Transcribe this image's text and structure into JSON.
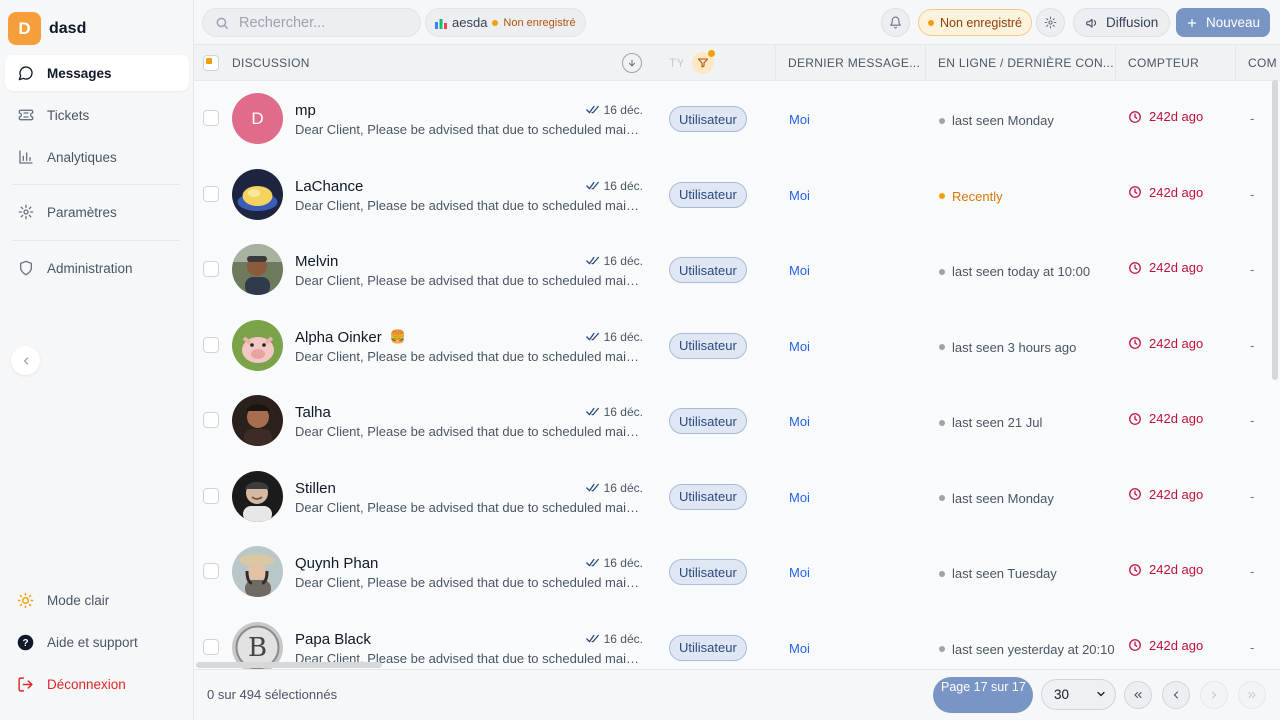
{
  "app": {
    "initial": "D",
    "name": "dasd"
  },
  "sidebar": {
    "items": [
      {
        "label": "Messages",
        "icon": "message-circle-icon",
        "active": true
      },
      {
        "label": "Tickets",
        "icon": "ticket-icon"
      },
      {
        "label": "Analytiques",
        "icon": "bar-chart-icon"
      },
      {
        "label": "Paramètres",
        "icon": "gear-icon"
      },
      {
        "label": "Administration",
        "icon": "shield-icon"
      }
    ],
    "bottom": [
      {
        "label": "Mode clair",
        "icon": "sun-icon"
      },
      {
        "label": "Aide et support",
        "icon": "help-circle-icon"
      },
      {
        "label": "Déconnexion",
        "icon": "logout-icon"
      }
    ]
  },
  "topbar": {
    "search_placeholder": "Rechercher...",
    "workspace": {
      "name": "aesda",
      "status": "Non enregistré"
    },
    "status_pill": "Non enregistré",
    "diffusion_label": "Diffusion",
    "new_label": "Nouveau"
  },
  "table": {
    "headers": {
      "discussion": "DISCUSSION",
      "type": "TY",
      "last_message": "DERNIER MESSAGE...",
      "online": "EN LIGNE / DERNIÈRE CON...",
      "counter": "COMPTEUR",
      "extra": "COM"
    },
    "rows": [
      {
        "name": "mp",
        "preview": "Dear Client, Please be advised that due to scheduled maintenance",
        "date": "16 déc.",
        "type": "Utilisateur",
        "last_by": "Moi",
        "online": "last seen Monday",
        "recent": false,
        "counter": "242d ago",
        "extra": "-",
        "avatar": "letter",
        "letter": "D"
      },
      {
        "name": "LaChance",
        "preview": "Dear Client, Please be advised that due to scheduled maintenance",
        "date": "16 déc.",
        "type": "Utilisateur",
        "last_by": "Moi",
        "online": "Recently",
        "recent": true,
        "counter": "242d ago",
        "extra": "-",
        "avatar": "photo-food"
      },
      {
        "name": "Melvin",
        "preview": "Dear Client, Please be advised that due to scheduled maintenance",
        "date": "16 déc.",
        "type": "Utilisateur",
        "last_by": "Moi",
        "online": "last seen today at 10:00",
        "recent": false,
        "counter": "242d ago",
        "extra": "-",
        "avatar": "photo-man-outdoor"
      },
      {
        "name": "Alpha Oinker",
        "name_badge": "🍔",
        "preview": "Dear Client, Please be advised that due to scheduled maintenance",
        "date": "16 déc.",
        "type": "Utilisateur",
        "last_by": "Moi",
        "online": "last seen 3 hours ago",
        "recent": false,
        "counter": "242d ago",
        "extra": "-",
        "avatar": "photo-pig"
      },
      {
        "name": "Talha",
        "preview": "Dear Client, Please be advised that due to scheduled maintenance",
        "date": "16 déc.",
        "type": "Utilisateur",
        "last_by": "Moi",
        "online": "last seen 21 Jul",
        "recent": false,
        "counter": "242d ago",
        "extra": "-",
        "avatar": "photo-man-dark"
      },
      {
        "name": "Stillen",
        "preview": "Dear Client, Please be advised that due to scheduled maintenance",
        "date": "16 déc.",
        "type": "Utilisateur",
        "last_by": "Moi",
        "online": "last seen Monday",
        "recent": false,
        "counter": "242d ago",
        "extra": "-",
        "avatar": "photo-man-smile"
      },
      {
        "name": "Quynh Phan",
        "preview": "Dear Client, Please be advised that due to scheduled maintenance",
        "date": "16 déc.",
        "type": "Utilisateur",
        "last_by": "Moi",
        "online": "last seen Tuesday",
        "recent": false,
        "counter": "242d ago",
        "extra": "-",
        "avatar": "photo-woman-hat"
      },
      {
        "name": "Papa Black",
        "preview": "Dear Client, Please be advised that due to scheduled maintenance",
        "date": "16 déc.",
        "type": "Utilisateur",
        "last_by": "Moi",
        "online": "last seen yesterday at 20:10",
        "recent": false,
        "counter": "242d ago",
        "extra": "-",
        "avatar": "photo-monogram"
      }
    ]
  },
  "footer": {
    "selection": "0 sur 494 sélectionnés",
    "page_label": "Page 17 sur 17",
    "page_size": "30"
  },
  "colors": {
    "accent": "#7895c6",
    "brand": "#f59e3b",
    "counter": "#be123c",
    "link": "#2563eb"
  }
}
